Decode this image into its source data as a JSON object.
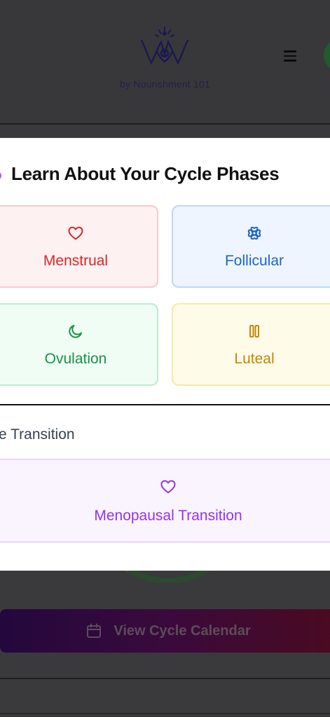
{
  "header": {
    "brand_byline": "by Nourishment 101",
    "logo_icon": "lotus-w-logo-icon",
    "menu_icon": "hamburger-menu-icon"
  },
  "modal": {
    "title": "Learn About Your Cycle Phases",
    "phases": [
      {
        "label": "Menstrual",
        "icon": "heart-icon",
        "color": "#dc2626"
      },
      {
        "label": "Follicular",
        "icon": "flower-icon",
        "color": "#1d64c7"
      },
      {
        "label": "Ovulation",
        "icon": "moon-icon",
        "color": "#159447"
      },
      {
        "label": "Luteal",
        "icon": "pause-icon",
        "color": "#c28606"
      }
    ],
    "transition_section_label": "e Transition",
    "transition_card": {
      "label": "Menopausal Transition",
      "icon": "heart-icon",
      "color": "#9333ea"
    }
  },
  "background": {
    "calendar_button_label": "View Cycle Calendar",
    "calendar_icon": "calendar-icon"
  }
}
